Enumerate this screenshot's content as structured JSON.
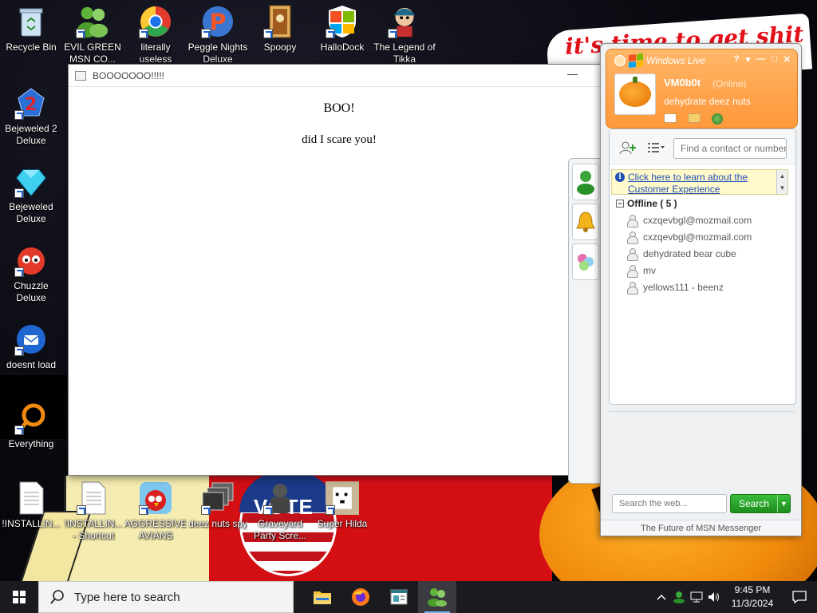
{
  "desktop": {
    "wallpaper_text": "it's time to get shit",
    "wallpaper_badge": "VOTE",
    "icons": [
      {
        "label": "Recycle Bin"
      },
      {
        "label": "EVIL GREEN MSN CO..."
      },
      {
        "label": "literally useless"
      },
      {
        "label": "Peggle Nights Deluxe"
      },
      {
        "label": "Spoopy"
      },
      {
        "label": "HalloDock"
      },
      {
        "label": "The Legend of Tikka"
      },
      {
        "label": "Bejeweled 2 Deluxe"
      },
      {
        "label": "Bejeweled Deluxe"
      },
      {
        "label": "Chuzzle Deluxe"
      },
      {
        "label": "doesnt load"
      },
      {
        "label": "Everything"
      },
      {
        "label": "!INSTALLIN..."
      },
      {
        "label": "!INSTALLIN... - Shortcut"
      },
      {
        "label": "AGGRESSIVE AVIANS"
      },
      {
        "label": "deez nuts spy"
      },
      {
        "label": "Graveyard Party Scre..."
      },
      {
        "label": "Super Hilda"
      }
    ]
  },
  "boo_window": {
    "title": "BOOOOOOO!!!!!",
    "heading": "BOO!",
    "body": "did I scare you!",
    "minimize": "—"
  },
  "msn": {
    "brand": "Windows Live",
    "controls": {
      "help": "?",
      "dropdown": "▾",
      "minimize": "—",
      "maximize": "□",
      "close": "✕"
    },
    "user": {
      "name": "VM0b0t",
      "status": "(Online)",
      "personal_message": "dehydrate deez nuts"
    },
    "find_placeholder": "Find a contact or number",
    "info_link": "Click here to learn about the Customer Experience",
    "group": {
      "name": "Offline ( 5 )",
      "toggle": "−"
    },
    "contacts": [
      {
        "name": "cxzqevbgl@mozmail.com"
      },
      {
        "name": "cxzqevbgl@mozmail.com"
      },
      {
        "name": "dehydrated bear cube"
      },
      {
        "name": "mv"
      },
      {
        "name": "yellows111 - beenz"
      }
    ],
    "web_search_placeholder": "Search the web...",
    "search_button": "Search",
    "footer": "The Future of MSN Messenger"
  },
  "taskbar": {
    "search_placeholder": "Type here to search",
    "apps": [
      {
        "name": "File Explorer",
        "icon": "folder-icon"
      },
      {
        "name": "Firefox",
        "icon": "firefox-icon"
      },
      {
        "name": "Window app",
        "icon": "window-app-icon"
      },
      {
        "name": "Windows Live Messenger",
        "icon": "msn-icon",
        "active": true
      }
    ],
    "time": "9:45 PM",
    "date": "11/3/2024"
  }
}
